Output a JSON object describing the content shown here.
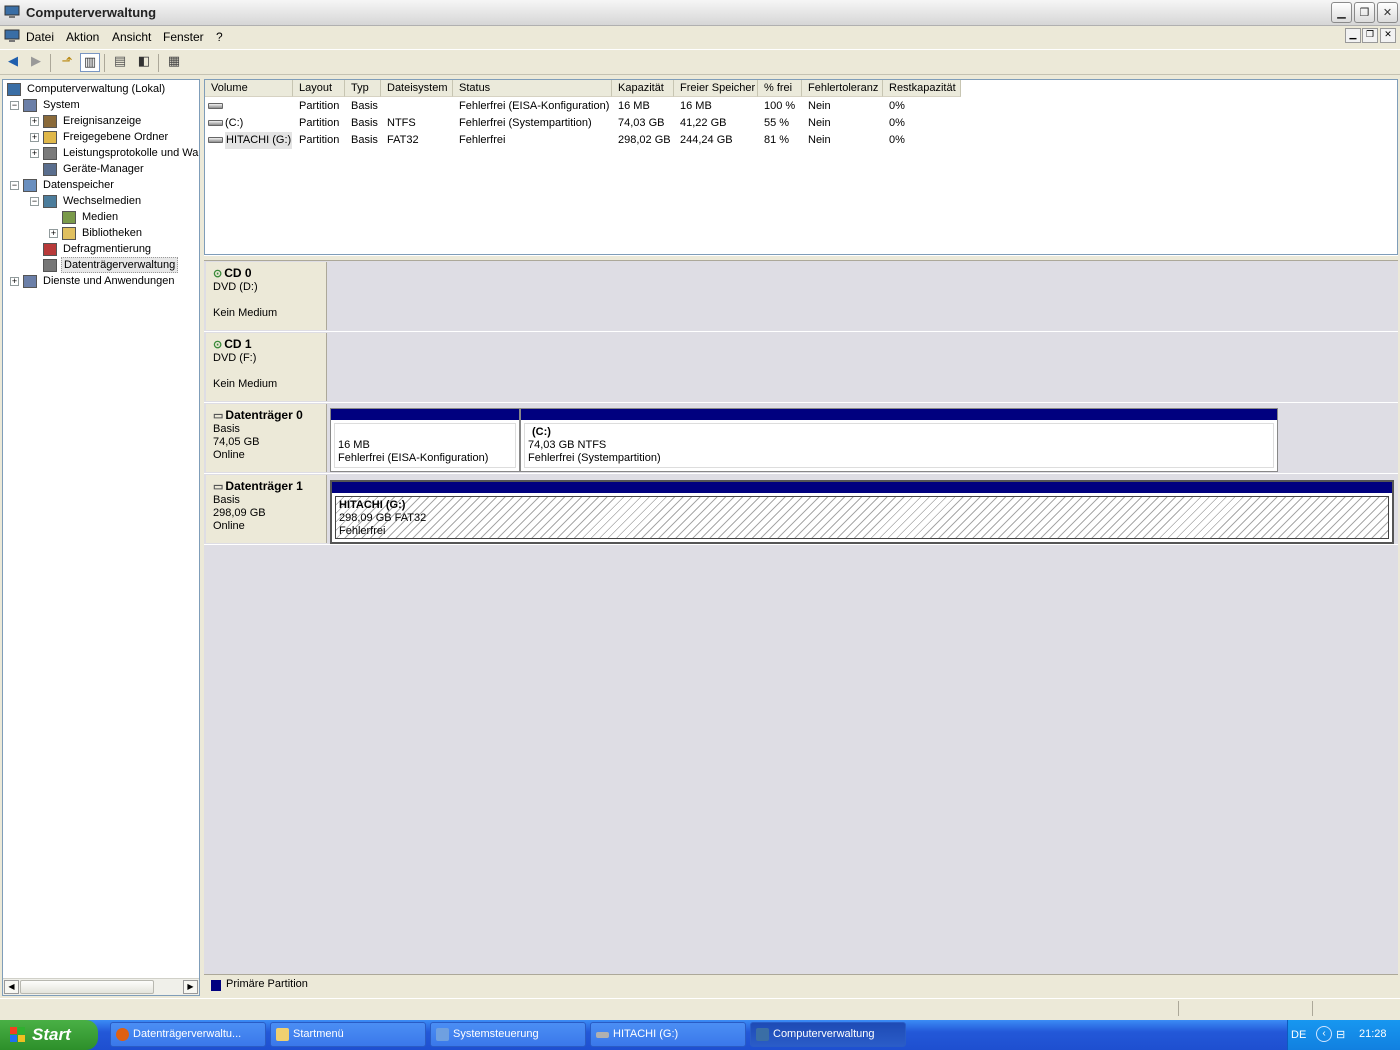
{
  "window": {
    "title": "Computerverwaltung"
  },
  "menu": [
    "Datei",
    "Aktion",
    "Ansicht",
    "Fenster",
    "?"
  ],
  "tree": [
    {
      "label": "Computerverwaltung (Lokal)",
      "level": 0,
      "expander": ""
    },
    {
      "label": "System",
      "level": 1,
      "expander": "-"
    },
    {
      "label": "Ereignisanzeige",
      "level": 2,
      "expander": "+"
    },
    {
      "label": "Freigegebene Ordner",
      "level": 2,
      "expander": "+"
    },
    {
      "label": "Leistungsprotokolle und War",
      "level": 2,
      "expander": "+"
    },
    {
      "label": "Geräte-Manager",
      "level": 2,
      "expander": ""
    },
    {
      "label": "Datenspeicher",
      "level": 1,
      "expander": "-"
    },
    {
      "label": "Wechselmedien",
      "level": 2,
      "expander": "-"
    },
    {
      "label": "Medien",
      "level": 3,
      "expander": ""
    },
    {
      "label": "Bibliotheken",
      "level": 3,
      "expander": "+"
    },
    {
      "label": "Defragmentierung",
      "level": 2,
      "expander": ""
    },
    {
      "label": "Datenträgerverwaltung",
      "level": 2,
      "expander": "",
      "selected": true
    },
    {
      "label": "Dienste und Anwendungen",
      "level": 1,
      "expander": "+"
    }
  ],
  "volumes": {
    "columns": [
      "Volume",
      "Layout",
      "Typ",
      "Dateisystem",
      "Status",
      "Kapazität",
      "Freier Speicher",
      "% frei",
      "Fehlertoleranz",
      "Restkapazität"
    ],
    "rows": [
      [
        "",
        "Partition",
        "Basis",
        "",
        "Fehlerfrei (EISA-Konfiguration)",
        "16 MB",
        "16 MB",
        "100 %",
        "Nein",
        "0%"
      ],
      [
        "(C:)",
        "Partition",
        "Basis",
        "NTFS",
        "Fehlerfrei (Systempartition)",
        "74,03 GB",
        "41,22 GB",
        "55 %",
        "Nein",
        "0%"
      ],
      [
        "HITACHI (G:)",
        "Partition",
        "Basis",
        "FAT32",
        "Fehlerfrei",
        "298,02 GB",
        "244,24 GB",
        "81 %",
        "Nein",
        "0%"
      ]
    ]
  },
  "disks": [
    {
      "name": "CD 0",
      "line1": "DVD (D:)",
      "line2": "",
      "line3": "Kein Medium"
    },
    {
      "name": "CD 1",
      "line1": "DVD (F:)",
      "line2": "",
      "line3": "Kein Medium"
    },
    {
      "name": "Datenträger 0",
      "line1": "Basis",
      "line2": "74,05 GB",
      "line3": "Online"
    },
    {
      "name": "Datenträger 1",
      "line1": "Basis",
      "line2": "298,09 GB",
      "line3": "Online"
    }
  ],
  "partitions": {
    "d0p1": {
      "title": "",
      "size": "16 MB",
      "status": "Fehlerfrei (EISA-Konfiguration)"
    },
    "d0p2": {
      "title": "(C:)",
      "size": "74,03 GB NTFS",
      "status": "Fehlerfrei (Systempartition)"
    },
    "d1p1": {
      "title": "HITACHI  (G:)",
      "size": "298,09 GB FAT32",
      "status": "Fehlerfrei"
    }
  },
  "legend": {
    "label": "Primäre Partition",
    "color": "#00007f"
  },
  "taskbar": {
    "start": "Start",
    "tasks": [
      "Datenträgerverwaltu...",
      "Startmenü",
      "Systemsteuerung",
      "HITACHI (G:)",
      "Computerverwaltung"
    ],
    "lang": "DE",
    "clock": "21:28"
  }
}
